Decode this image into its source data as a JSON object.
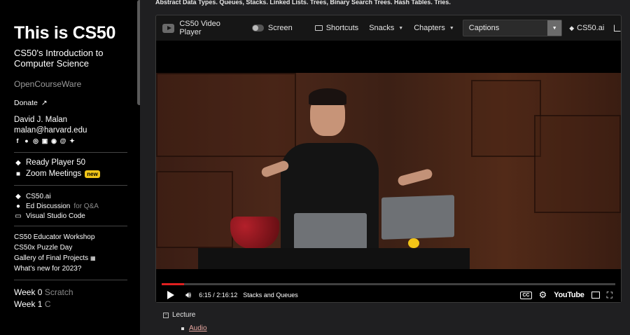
{
  "sidebar": {
    "title": "This is CS50",
    "subtitle": "CS50's Introduction to Computer Science",
    "ocw": "OpenCourseWare",
    "donate": "Donate",
    "author": "David J. Malan",
    "email": "malan@harvard.edu",
    "social_icons": [
      "facebook-icon",
      "github-icon",
      "instagram-icon",
      "linkedin-icon",
      "reddit-icon",
      "threads-icon",
      "twitter-icon"
    ],
    "group1": [
      {
        "label": "Ready Player 50",
        "icon": "duck-icon"
      },
      {
        "label": "Zoom Meetings",
        "icon": "video-icon",
        "badge": "new"
      }
    ],
    "group2": [
      {
        "label": "CS50.ai",
        "icon": "duck-icon"
      },
      {
        "label": "Ed Discussion",
        "suffix": "for Q&A",
        "icon": "chat-icon"
      },
      {
        "label": "Visual Studio Code",
        "icon": "monitor-icon"
      }
    ],
    "group3": [
      "CS50 Educator Workshop",
      "CS50x Puzzle Day",
      "Gallery of Final Projects",
      "What's new for 2023?"
    ],
    "weeks": [
      {
        "label": "Week 0",
        "topic": "Scratch"
      },
      {
        "label": "Week 1",
        "topic": "C"
      }
    ]
  },
  "main": {
    "topline": "Abstract Data Types. Queues, Stacks. Linked Lists. Trees, Binary Search Trees. Hash Tables. Tries.",
    "player": {
      "title": "CS50 Video Player",
      "screen_label": "Screen",
      "shortcuts": "Shortcuts",
      "snacks": "Snacks",
      "chapters": "Chapters",
      "captions": "Captions",
      "cs50ai": "CS50.ai",
      "time": "6:15 / 2:16:12",
      "chapter_name": "Stacks and Queues",
      "youtube": "YouTube",
      "cc": "CC",
      "progress": 0.05
    },
    "lecture": "Lecture",
    "audio": "Audio"
  }
}
